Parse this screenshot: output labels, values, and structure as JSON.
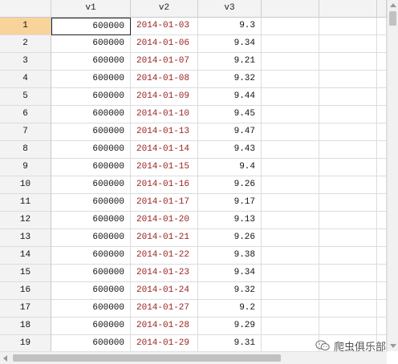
{
  "columns": [
    "v1",
    "v2",
    "v3"
  ],
  "rows": [
    {
      "n": "1",
      "v1": "600000",
      "v2": "2014-01-03",
      "v3": "9.3"
    },
    {
      "n": "2",
      "v1": "600000",
      "v2": "2014-01-06",
      "v3": "9.34"
    },
    {
      "n": "3",
      "v1": "600000",
      "v2": "2014-01-07",
      "v3": "9.21"
    },
    {
      "n": "4",
      "v1": "600000",
      "v2": "2014-01-08",
      "v3": "9.32"
    },
    {
      "n": "5",
      "v1": "600000",
      "v2": "2014-01-09",
      "v3": "9.44"
    },
    {
      "n": "6",
      "v1": "600000",
      "v2": "2014-01-10",
      "v3": "9.45"
    },
    {
      "n": "7",
      "v1": "600000",
      "v2": "2014-01-13",
      "v3": "9.47"
    },
    {
      "n": "8",
      "v1": "600000",
      "v2": "2014-01-14",
      "v3": "9.43"
    },
    {
      "n": "9",
      "v1": "600000",
      "v2": "2014-01-15",
      "v3": "9.4"
    },
    {
      "n": "10",
      "v1": "600000",
      "v2": "2014-01-16",
      "v3": "9.26"
    },
    {
      "n": "11",
      "v1": "600000",
      "v2": "2014-01-17",
      "v3": "9.17"
    },
    {
      "n": "12",
      "v1": "600000",
      "v2": "2014-01-20",
      "v3": "9.13"
    },
    {
      "n": "13",
      "v1": "600000",
      "v2": "2014-01-21",
      "v3": "9.26"
    },
    {
      "n": "14",
      "v1": "600000",
      "v2": "2014-01-22",
      "v3": "9.38"
    },
    {
      "n": "15",
      "v1": "600000",
      "v2": "2014-01-23",
      "v3": "9.34"
    },
    {
      "n": "16",
      "v1": "600000",
      "v2": "2014-01-24",
      "v3": "9.32"
    },
    {
      "n": "17",
      "v1": "600000",
      "v2": "2014-01-27",
      "v3": "9.2"
    },
    {
      "n": "18",
      "v1": "600000",
      "v2": "2014-01-28",
      "v3": "9.29"
    },
    {
      "n": "19",
      "v1": "600000",
      "v2": "2014-01-29",
      "v3": "9.31"
    }
  ],
  "watermark": {
    "text": "爬虫俱乐部",
    "icon": "wechat-icon"
  },
  "colors": {
    "date_text": "#9b1e1e",
    "active_row_header": "#f8d49a",
    "header_bg": "#f3f3f3"
  }
}
